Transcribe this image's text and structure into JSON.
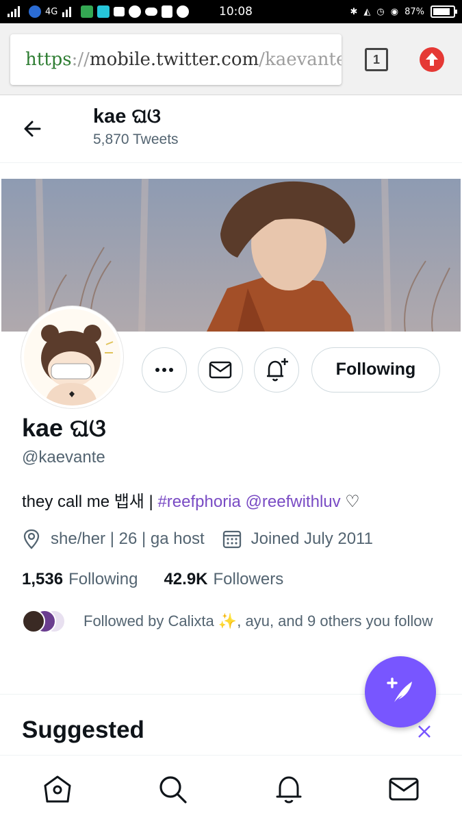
{
  "status_bar": {
    "network": "4G",
    "time": "10:08",
    "battery_text": "87%",
    "battery_level": 0.87
  },
  "browser": {
    "url_scheme": "https",
    "url_sep": "://",
    "url_host": "mobile.twitter.com",
    "url_slash": "/",
    "url_path": "kaevante",
    "tab_count": "1"
  },
  "header": {
    "name": "kae ଘଓ",
    "tweets": "5,870 Tweets"
  },
  "profile": {
    "display_name": "kae ଘଓ",
    "handle": "@kaevante",
    "bio_text": "they call me 뱁새 | ",
    "bio_hashtag": "#reefphoria",
    "bio_space": " ",
    "bio_mention": "@reefwithluv",
    "bio_end": " ♡",
    "location": "she/her | 26 | ga host",
    "joined": "Joined July 2011",
    "following_count": "1,536",
    "following_label": "Following",
    "followers_count": "42.9K",
    "followers_label": "Followers",
    "followed_by": "Followed by Calixta ✨, ayu, and 9 others you follow",
    "follow_button": "Following"
  },
  "suggested": {
    "title": "Suggested"
  },
  "colors": {
    "accent": "#7856ff",
    "link": "#794bc4",
    "secondary_text": "#536471"
  },
  "icons": {
    "back": "arrow-left-icon",
    "more": "more-icon",
    "message": "mail-icon",
    "notify": "bell-plus-icon",
    "location": "location-pin-icon",
    "calendar": "calendar-icon",
    "compose": "compose-feather-icon",
    "close": "close-icon",
    "nav": [
      "home-icon",
      "search-icon",
      "bell-icon",
      "mail-icon"
    ]
  }
}
